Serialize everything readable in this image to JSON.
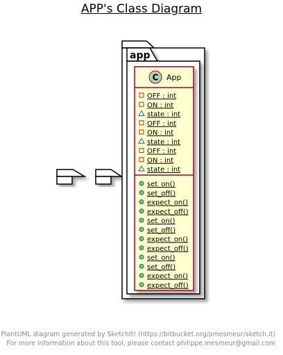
{
  "title": "APP's Class Diagram",
  "package": {
    "name": "app"
  },
  "class": {
    "name": "App",
    "stereotype_letter": "C",
    "attributes": [
      {
        "visibility": "private",
        "text": "OFF : int"
      },
      {
        "visibility": "private",
        "text": "ON : int"
      },
      {
        "visibility": "package",
        "text": "state : int"
      },
      {
        "visibility": "private",
        "text": "OFF : int"
      },
      {
        "visibility": "private",
        "text": "ON : int"
      },
      {
        "visibility": "package",
        "text": "state : int"
      },
      {
        "visibility": "private",
        "text": "OFF : int"
      },
      {
        "visibility": "private",
        "text": "ON : int"
      },
      {
        "visibility": "package",
        "text": "state : int"
      }
    ],
    "methods": [
      {
        "visibility": "public",
        "text": "set_on()"
      },
      {
        "visibility": "public",
        "text": "set_off()"
      },
      {
        "visibility": "public",
        "text": "expect_on()"
      },
      {
        "visibility": "public",
        "text": "expect_off()"
      },
      {
        "visibility": "public",
        "text": "set_on()"
      },
      {
        "visibility": "public",
        "text": "set_off()"
      },
      {
        "visibility": "public",
        "text": "expect_on()"
      },
      {
        "visibility": "public",
        "text": "expect_off()"
      },
      {
        "visibility": "public",
        "text": "set_on()"
      },
      {
        "visibility": "public",
        "text": "set_off()"
      },
      {
        "visibility": "public",
        "text": "expect_on()"
      },
      {
        "visibility": "public",
        "text": "expect_off()"
      }
    ]
  },
  "footer": {
    "line1": "PlantUML diagram generated by SketchIt! (https://bitbucket.org/pmesmeur/sketch.it)",
    "line2": "For more information about this tool, please contact philippe.mesmeur@gmail.com"
  },
  "colors": {
    "class_fill": "#FEFECE",
    "class_border": "#A80036",
    "private_icon": "#C82930",
    "package_icon": "#1963A0",
    "public_icon_fill": "#84BE84",
    "public_icon_border": "#038048",
    "stereotype_circle": "#ADD1B2",
    "footer_text": "#888888"
  }
}
